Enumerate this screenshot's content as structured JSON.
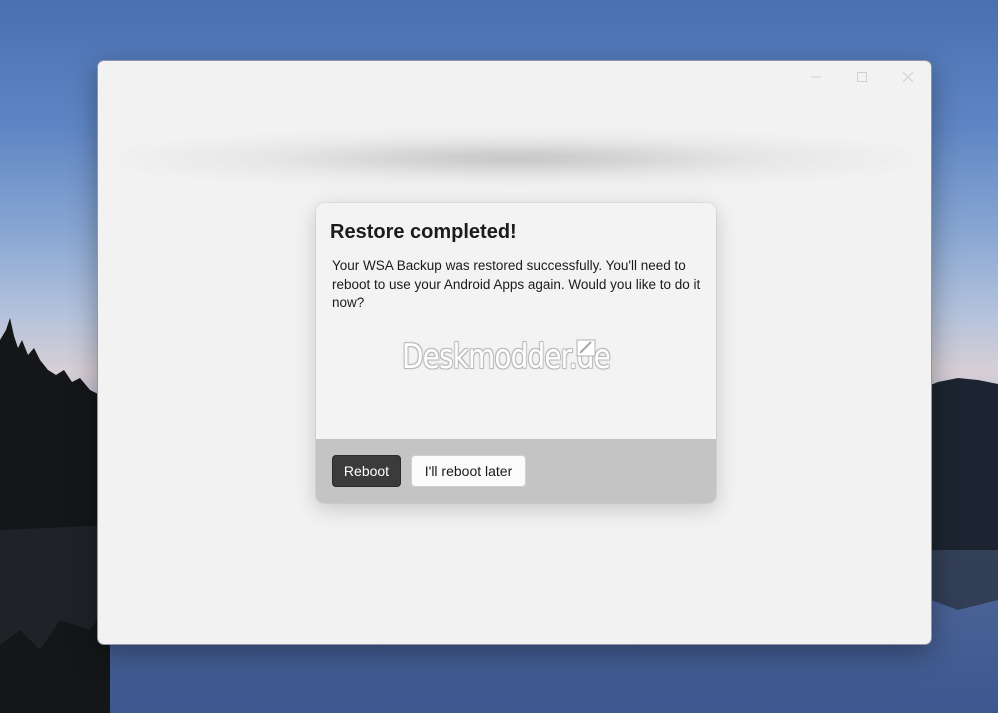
{
  "window": {
    "caption_buttons": [
      {
        "name": "minimize-icon",
        "glyph": "—"
      },
      {
        "name": "maximize-icon",
        "glyph": "☐"
      },
      {
        "name": "close-icon",
        "glyph": "✕"
      }
    ]
  },
  "dialog": {
    "title": "Restore completed!",
    "body": "Your WSA Backup was restored successfully. You'll need to reboot to use your Android Apps again. Would you like to do it now?",
    "primary_button": "Reboot",
    "secondary_button": "I'll reboot later"
  },
  "watermark": {
    "text": "Deskmodder.de",
    "icon": "pencil-icon"
  },
  "colors": {
    "primary_button_bg": "#3b3b3b",
    "footer_bg": "#c4c4c4",
    "dialog_bg": "#f3f3f3",
    "window_bg": "#f2f2f3"
  }
}
